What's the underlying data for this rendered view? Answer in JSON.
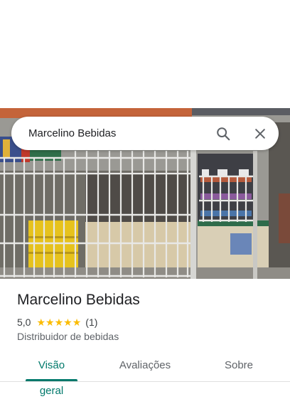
{
  "search": {
    "query": "Marcelino Bebidas",
    "search_icon": "search-icon",
    "close_icon": "close-icon"
  },
  "place": {
    "name": "Marcelino Bebidas",
    "rating": "5,0",
    "stars": 5,
    "review_count": "(1)",
    "category": "Distribuidor de bebidas"
  },
  "tabs": [
    {
      "label": "Visão geral",
      "active": true
    },
    {
      "label": "Avaliações",
      "active": false
    },
    {
      "label": "Sobre",
      "active": false
    }
  ],
  "colors": {
    "accent": "#00796b",
    "star": "#fbbc04"
  }
}
